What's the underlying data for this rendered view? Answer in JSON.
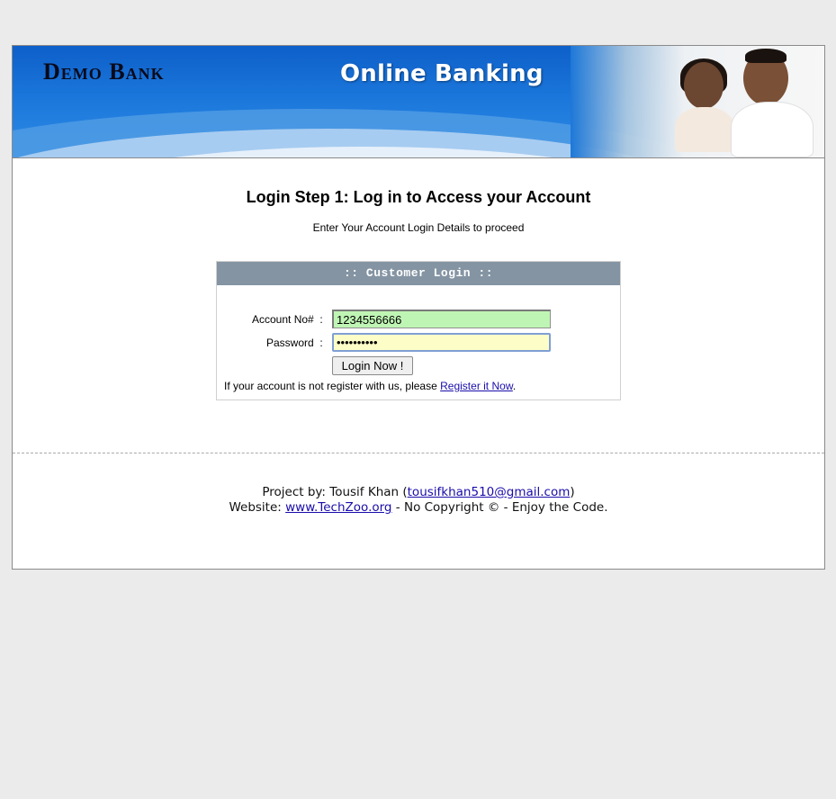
{
  "banner": {
    "logo": "Demo Bank",
    "title": "Online Banking"
  },
  "heading": "Login Step 1: Log in to Access your Account",
  "subheading": "Enter Your Account Login Details to proceed",
  "login_box": {
    "header": ":: Customer Login ::",
    "account_label": "Account No#  :",
    "account_value": "1234556666",
    "password_label": "Password  :",
    "password_value": "••••••••••",
    "button_label": "Login Now !",
    "register_prefix": "If your account is not register with us, please ",
    "register_link": "Register it Now",
    "register_suffix": "."
  },
  "footer": {
    "project_prefix": "Project by: Tousif Khan (",
    "email": "tousifkhan510@gmail.com",
    "project_suffix": ")",
    "website_prefix": "Website: ",
    "website": "www.TechZoo.org",
    "website_suffix": " - No Copyright © - Enjoy the Code."
  },
  "colors": {
    "page_bg": "#ebebeb",
    "login_header_bg": "#8494a3",
    "account_input_bg": "#bff5b4",
    "password_input_bg": "#fdfdc8",
    "link": "#1a0dab"
  }
}
